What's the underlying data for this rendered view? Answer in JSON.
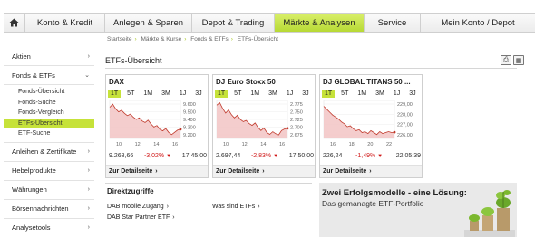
{
  "nav": {
    "home_icon": "home-icon",
    "items": [
      {
        "label": "Konto & Kredit"
      },
      {
        "label": "Anlegen & Sparen"
      },
      {
        "label": "Depot & Trading"
      },
      {
        "label": "Märkte & Analysen",
        "active": true
      },
      {
        "label": "Service"
      },
      {
        "label": "Mein Konto / Depot"
      }
    ]
  },
  "breadcrumb": [
    "Startseite",
    "Märkte & Kurse",
    "Fonds & ETFs",
    "ETFs-Übersicht"
  ],
  "sidebar": {
    "items": [
      {
        "label": "Aktien"
      },
      {
        "label": "Fonds & ETFs"
      },
      {
        "label": "Anleihen & Zertifikate"
      },
      {
        "label": "Hebelprodukte"
      },
      {
        "label": "Währungen"
      },
      {
        "label": "Börsennachrichten"
      },
      {
        "label": "Analysetools"
      }
    ],
    "subitems": [
      {
        "label": "Fonds-Übersicht"
      },
      {
        "label": "Fonds-Suche"
      },
      {
        "label": "Fonds-Vergleich"
      },
      {
        "label": "ETFs-Übersicht",
        "active": true
      },
      {
        "label": "ETF-Suche"
      }
    ]
  },
  "page": {
    "title": "ETFs-Übersicht",
    "icons": [
      "print-icon",
      "calculator-icon"
    ]
  },
  "timeframes": [
    "1T",
    "5T",
    "1M",
    "3M",
    "1J",
    "3J"
  ],
  "cards": [
    {
      "title": "DAX",
      "value": "9.268,66",
      "change": "-3,02%",
      "time": "17:45:00",
      "link": "Zur Detailseite",
      "chart_data": {
        "type": "area",
        "x_labels": [
          "10",
          "12",
          "14",
          "16"
        ],
        "y_ticks": [
          "9.600",
          "9.500",
          "9.400",
          "9.300",
          "9.200"
        ],
        "ylim": [
          9150,
          9650
        ],
        "values": [
          9560,
          9600,
          9540,
          9500,
          9520,
          9480,
          9450,
          9470,
          9430,
          9400,
          9420,
          9380,
          9360,
          9390,
          9340,
          9300,
          9320,
          9270,
          9250,
          9280,
          9230,
          9200,
          9230,
          9260,
          9270
        ]
      }
    },
    {
      "title": "DJ Euro Stoxx 50",
      "value": "2.697,44",
      "change": "-2,83%",
      "time": "17:50:00",
      "link": "Zur Detailseite",
      "chart_data": {
        "type": "area",
        "x_labels": [
          "10",
          "12",
          "14",
          "16"
        ],
        "y_ticks": [
          "2.775",
          "2.750",
          "2.725",
          "2.700",
          "2.675"
        ],
        "ylim": [
          2665,
          2785
        ],
        "values": [
          2770,
          2778,
          2760,
          2745,
          2755,
          2740,
          2730,
          2738,
          2725,
          2718,
          2722,
          2712,
          2706,
          2714,
          2700,
          2690,
          2698,
          2684,
          2678,
          2686,
          2680,
          2676,
          2690,
          2695,
          2697
        ]
      }
    },
    {
      "title": "DJ GLOBAL TITANS 50 ...",
      "value": "226,24",
      "change": "-1,49%",
      "time": "22:05:39",
      "link": "Zur Detailseite",
      "chart_data": {
        "type": "area",
        "x_labels": [
          "16",
          "18",
          "20",
          "22"
        ],
        "y_ticks": [
          "229,00",
          "228,00",
          "227,00",
          "226,00"
        ],
        "ylim": [
          225.6,
          229.5
        ],
        "values": [
          228.9,
          228.6,
          228.3,
          228.0,
          227.8,
          227.6,
          227.3,
          227.1,
          226.8,
          226.9,
          226.6,
          226.4,
          226.5,
          226.2,
          226.3,
          226.1,
          226.4,
          226.2,
          226.0,
          226.3,
          226.1,
          226.2,
          226.3,
          226.2,
          226.24
        ]
      }
    }
  ],
  "direktzugriffe": {
    "title": "Direktzugriffe",
    "links": [
      {
        "label": "DAB mobile Zugang"
      },
      {
        "label": "DAB Star Partner ETF"
      },
      {
        "label": "Was sind ETFs"
      }
    ]
  },
  "promo": {
    "headline": "Zwei Erfolgsmodelle - eine Lösung:",
    "subline": "Das gemanagte ETF-Portfolio",
    "colors": {
      "accent": "#c6e23a",
      "chart_fill": "#f2c4c4",
      "chart_line": "#c0392b",
      "down": "#d01a1a"
    }
  }
}
